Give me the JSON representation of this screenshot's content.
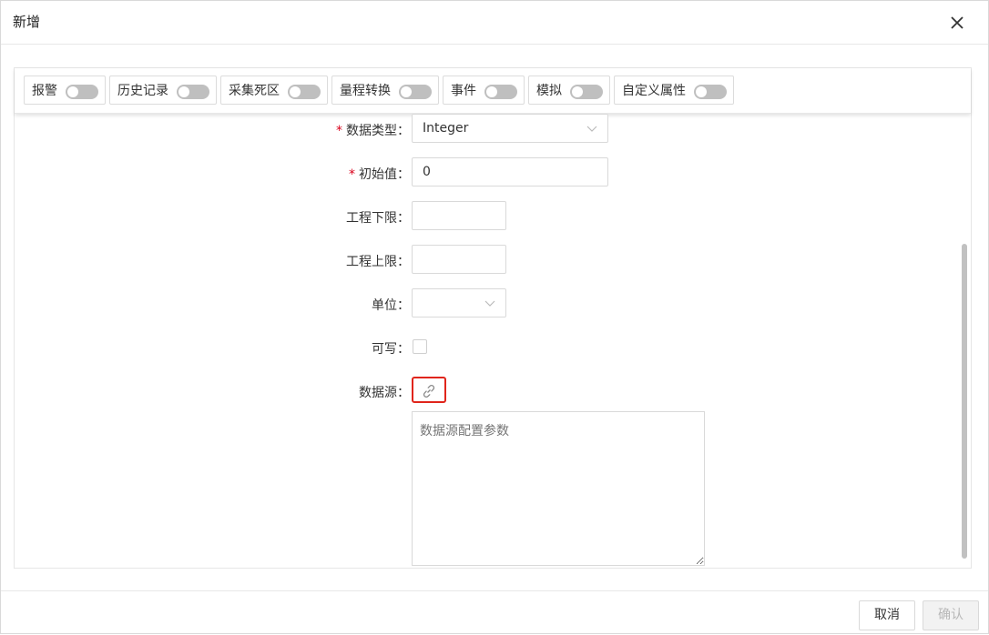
{
  "dialog": {
    "title": "新增"
  },
  "tabs": [
    {
      "label": "报警",
      "on": false
    },
    {
      "label": "历史记录",
      "on": false
    },
    {
      "label": "采集死区",
      "on": false
    },
    {
      "label": "量程转换",
      "on": false
    },
    {
      "label": "事件",
      "on": false
    },
    {
      "label": "模拟",
      "on": false
    },
    {
      "label": "自定义属性",
      "on": false
    }
  ],
  "form": {
    "data_type": {
      "label": "数据类型：",
      "value": "Integer",
      "required": true
    },
    "initial_value": {
      "label": "初始值：",
      "value": "0",
      "required": true
    },
    "eng_low": {
      "label": "工程下限：",
      "value": ""
    },
    "eng_high": {
      "label": "工程上限：",
      "value": ""
    },
    "unit": {
      "label": "单位：",
      "value": ""
    },
    "writable": {
      "label": "可写：",
      "checked": false
    },
    "data_source": {
      "label": "数据源：",
      "icon": "link-icon"
    },
    "source_params": {
      "placeholder": "数据源配置参数"
    }
  },
  "footer": {
    "cancel_label": "取消",
    "confirm_label": "确认"
  },
  "colors": {
    "required": "#d9001b",
    "highlight_border": "#e0251b",
    "switch_off": "#bfbfbf"
  }
}
